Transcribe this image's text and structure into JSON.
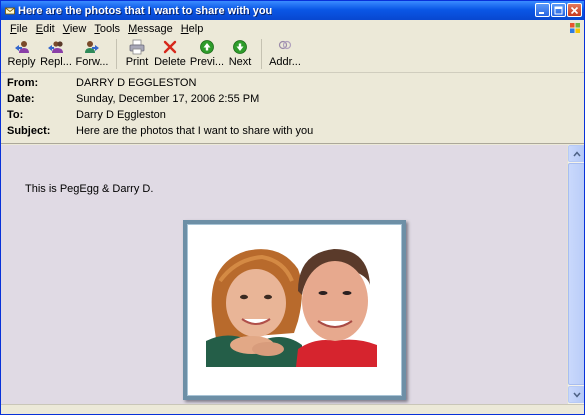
{
  "window": {
    "title": "Here are the photos that I want to share with you"
  },
  "menu": [
    {
      "label": "File",
      "accel": "F",
      "rest": "ile"
    },
    {
      "label": "Edit",
      "accel": "E",
      "rest": "dit"
    },
    {
      "label": "View",
      "accel": "V",
      "rest": "iew"
    },
    {
      "label": "Tools",
      "accel": "T",
      "rest": "ools"
    },
    {
      "label": "Message",
      "accel": "M",
      "rest": "essage"
    },
    {
      "label": "Help",
      "accel": "H",
      "rest": "elp"
    }
  ],
  "toolbar": {
    "reply": "Reply",
    "reply_all": "Repl...",
    "forward": "Forw...",
    "print": "Print",
    "delete": "Delete",
    "previous": "Previ...",
    "next": "Next",
    "addresses": "Addr..."
  },
  "headers": {
    "from_label": "From:",
    "from_value": "DARRY D EGGLESTON",
    "date_label": "Date:",
    "date_value": "Sunday, December 17, 2006 2:55 PM",
    "to_label": "To:",
    "to_value": "Darry D Eggleston",
    "subject_label": "Subject:",
    "subject_value": "Here are the photos that I want to share with you"
  },
  "message": {
    "body_text": "This is PegEgg & Darry D."
  },
  "icons": {
    "reply": "reply-icon",
    "reply_all": "reply-all-icon",
    "forward": "forward-icon",
    "print": "printer-icon",
    "delete": "delete-x-icon",
    "previous": "previous-arrow-icon",
    "next": "next-arrow-icon",
    "addresses": "address-book-icon"
  },
  "colors": {
    "titlebar": "#0A57E6",
    "body_background": "#E0DAE4",
    "frame_border": "#6D8FA6",
    "delete_red": "#D6281B",
    "nav_green": "#2E9C2B"
  }
}
